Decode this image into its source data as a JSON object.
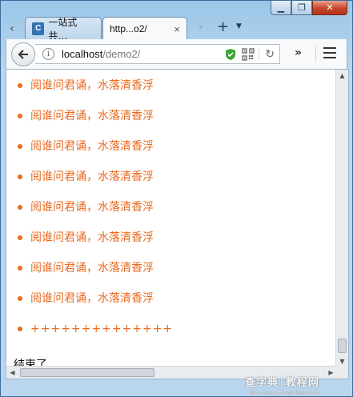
{
  "window": {
    "caption_icons": [
      "minimize-icon",
      "maximize-icon",
      "close-icon"
    ]
  },
  "tabs": [
    {
      "label": "一站式共…",
      "active": false
    },
    {
      "label": "http...o2/",
      "active": true
    }
  ],
  "tab_controls": {
    "close_glyph": "×",
    "new_tab_glyph": "+"
  },
  "toolbar": {
    "url_host": "localhost",
    "url_path": "/demo2/",
    "overflow_glyph": "»",
    "shield_color": "#3aa335"
  },
  "page": {
    "items": [
      "阅谁问君诵，水落清香浮",
      "阅谁问君诵，水落清香浮",
      "阅谁问君诵，水落清香浮",
      "阅谁问君诵，水落清香浮",
      "阅谁问君诵，水落清香浮",
      "阅谁问君诵，水落清香浮",
      "阅谁问君诵，水落清香浮",
      "阅谁问君诵，水落清香浮",
      "++++++++++++++"
    ],
    "end_text": "结束了",
    "item_color": "#ec6a1f"
  },
  "watermark": {
    "main": "查字典│教程网",
    "sub": "jiaocheng.chazidian.com"
  }
}
